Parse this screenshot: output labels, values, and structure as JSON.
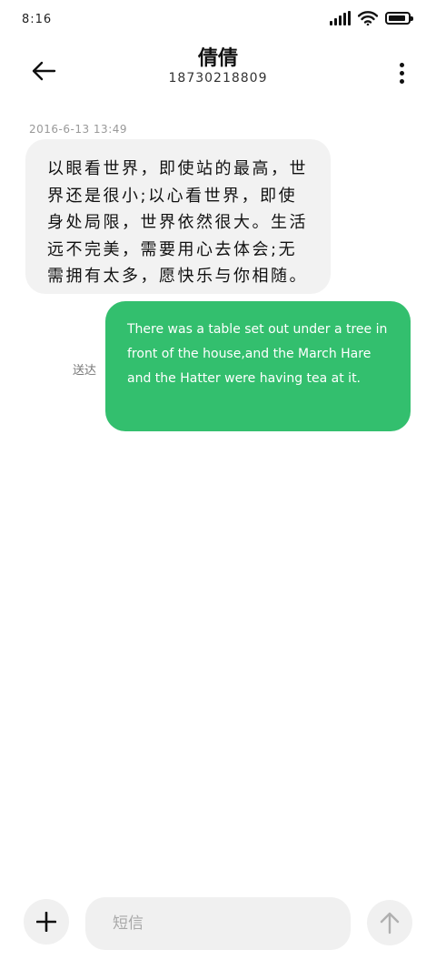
{
  "status_bar": {
    "time": "8:16",
    "battery_level": 0.9
  },
  "header": {
    "title": "倩倩",
    "subtitle": "18730218809",
    "back_icon": "arrow-left-icon",
    "more_icon": "more-vertical-icon"
  },
  "messages": {
    "timestamp": "2016-6-13 13:49",
    "incoming_text": "以眼看世界，即使站的最高，世界还是很小;以心看世界，即使身处局限，世界依然很大。生活远不完美，需要用心去体会;无需拥有太多，愿快乐与你相随。",
    "outgoing_text": "There was a table set out under a tree in front of the house,and the March Hare and the Hatter were having tea at it.",
    "delivered_label": "送达"
  },
  "composer": {
    "placeholder": "短信",
    "add_icon": "plus-icon",
    "send_icon": "arrow-up-icon"
  },
  "colors": {
    "outgoing_bubble": "#33bf6e",
    "incoming_bubble": "#f2f2f2",
    "input_bg": "#f0f0f0"
  }
}
